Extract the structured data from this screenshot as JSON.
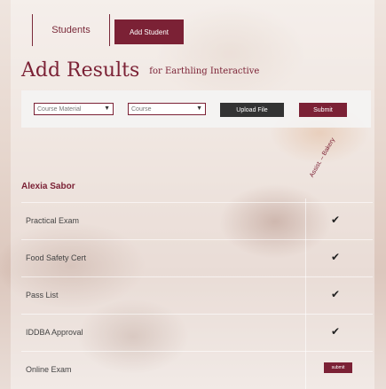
{
  "tabs": {
    "students": "Students",
    "add_student": "Add Student"
  },
  "page": {
    "title": "Add Results",
    "subtitle": "for Earthling Interactive"
  },
  "toolbar": {
    "course_material": "Course Material",
    "course": "Course",
    "upload": "Upload File",
    "submit": "Submit"
  },
  "column_header": "Assist. – Bakery",
  "student": {
    "name": "Alexia Sabor"
  },
  "rows": [
    {
      "label": "Practical Exam",
      "status": "✔"
    },
    {
      "label": "Food Safety Cert",
      "status": "✔"
    },
    {
      "label": "Pass List",
      "status": "✔"
    },
    {
      "label": "IDDBA Approval",
      "status": "✔"
    },
    {
      "label": "Online Exam",
      "button": "submit"
    }
  ],
  "colors": {
    "accent": "#7b2135",
    "dark_button": "#333333"
  }
}
